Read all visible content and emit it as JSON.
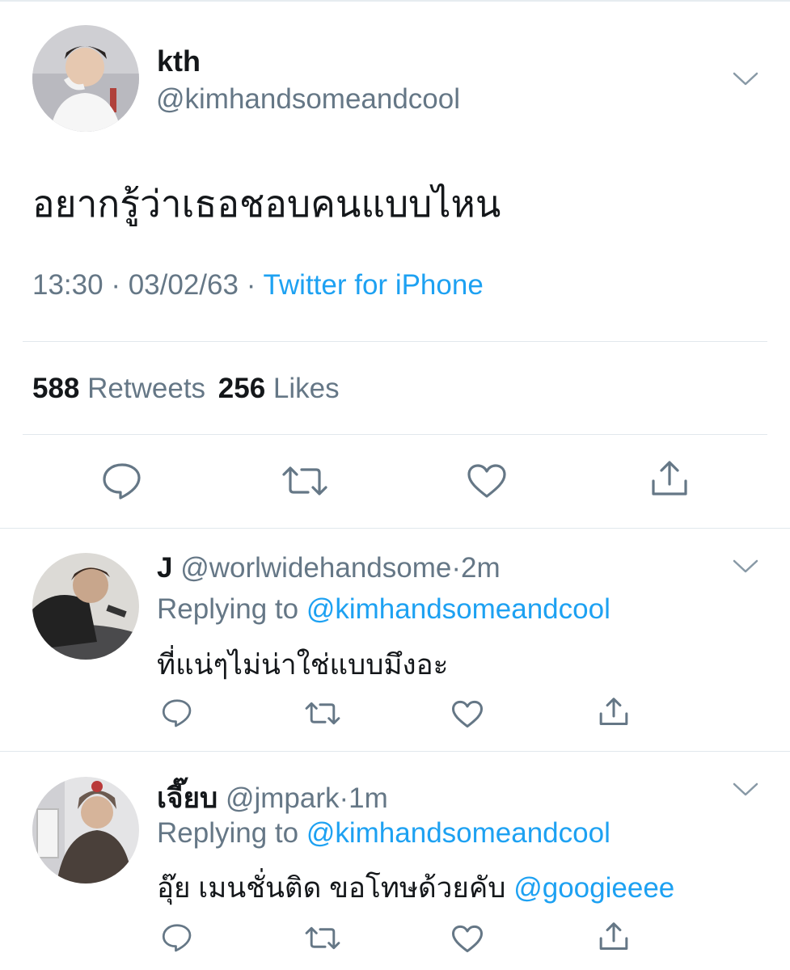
{
  "main_tweet": {
    "display_name": "kth",
    "handle": "@kimhandsomeandcool",
    "text": "อยากรู้ว่าเธอชอบคนแบบไหน",
    "time": "13:30",
    "date": "03/02/63",
    "dot": "·",
    "source": "Twitter for iPhone",
    "retweets_count": "588",
    "retweets_label": "Retweets",
    "likes_count": "256",
    "likes_label": "Likes"
  },
  "replies": [
    {
      "display_name": "J",
      "handle": "@worlwidehandsome",
      "dot": "·",
      "time": "2m",
      "replying_label": "Replying to",
      "replying_to": "@kimhandsomeandcool",
      "text": "ที่แน่ๆไม่น่าใช่แบบมึงอะ"
    },
    {
      "display_name": "เจี๊ยบ",
      "handle": "@jmpark",
      "dot": "·",
      "time": "1m",
      "replying_label": "Replying to",
      "replying_to": "@kimhandsomeandcool",
      "text": "อุ๊ย เมนชั่นติด ขอโทษด้วยคับ",
      "mention": "@googieeee"
    }
  ],
  "icons": [
    "chevron-down-icon",
    "reply-icon",
    "retweet-icon",
    "like-icon",
    "share-icon"
  ],
  "colors": {
    "link": "#1da1f2",
    "muted": "#657786",
    "text": "#14171a",
    "separator": "#e1e8ed"
  }
}
